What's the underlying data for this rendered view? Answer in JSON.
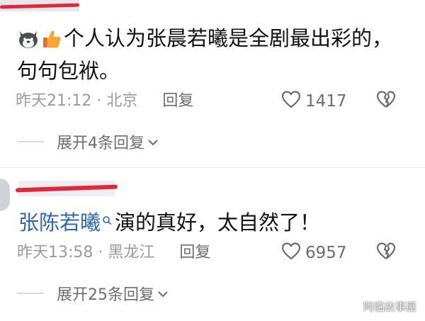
{
  "comments": [
    {
      "text_line1": "个人认为张晨若曦是全剧最出彩的，",
      "text_line2": "句句包袱。",
      "time": "昨天21:12",
      "sep": "·",
      "location": "北京",
      "reply_label": "回复",
      "likes": "1417",
      "expand_label": "展开4条回复"
    },
    {
      "mention": "张陈若曦",
      "text": "演的真好，太自然了！",
      "time": "昨天13:58",
      "sep": "·",
      "location": "黑龙江",
      "reply_label": "回复",
      "likes": "6957",
      "expand_label": "展开25条回复"
    }
  ],
  "watermark": "阿临故事屋",
  "colors": {
    "redaction": "#e0283c",
    "mention": "#2e67b3",
    "meta": "#9b9b9b"
  }
}
